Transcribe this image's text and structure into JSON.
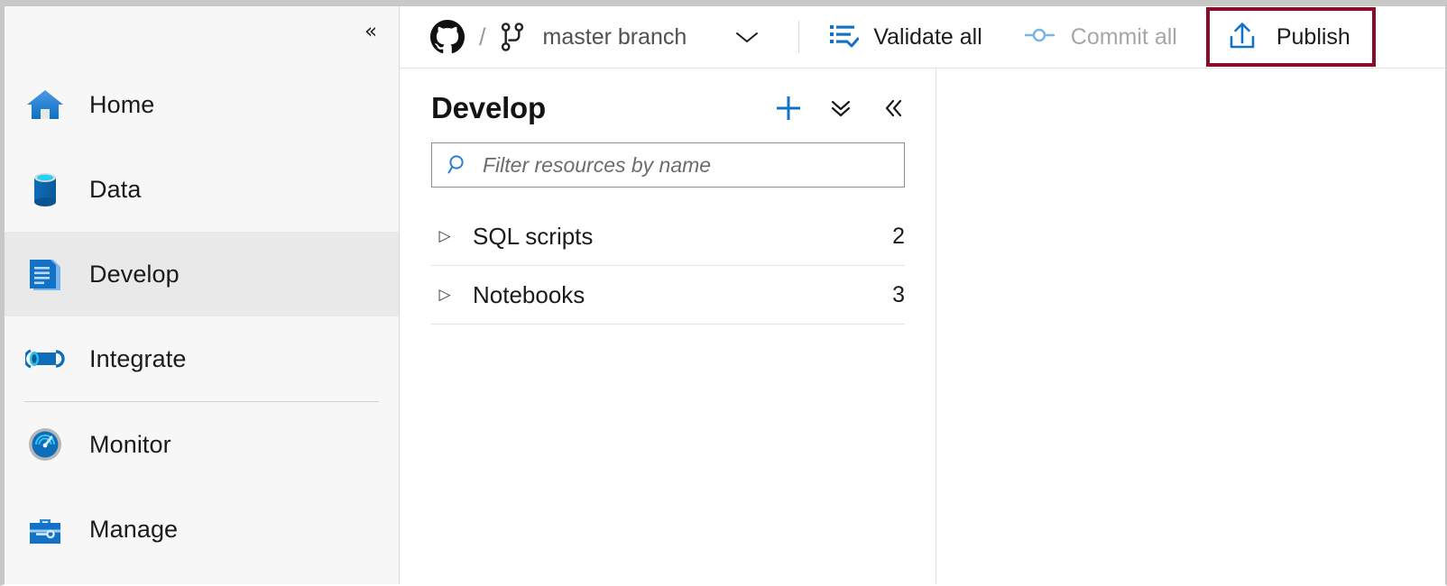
{
  "sidebar": {
    "collapse_icon": "«",
    "items": [
      {
        "label": "Home",
        "icon": "home-icon",
        "selected": false
      },
      {
        "label": "Data",
        "icon": "database-icon",
        "selected": false
      },
      {
        "label": "Develop",
        "icon": "document-icon",
        "selected": true
      },
      {
        "label": "Integrate",
        "icon": "pipeline-icon",
        "selected": false
      },
      {
        "label": "Monitor",
        "icon": "gauge-icon",
        "selected": false
      },
      {
        "label": "Manage",
        "icon": "toolbox-icon",
        "selected": false
      }
    ]
  },
  "topbar": {
    "github_icon": "github-icon",
    "separator": "/",
    "branch_icon": "git-branch-icon",
    "branch_name": "master branch",
    "branch_chevron_icon": "chevron-down-icon",
    "validate_all": {
      "label": "Validate all",
      "icon": "list-check-icon",
      "enabled": true
    },
    "commit_all": {
      "label": "Commit all",
      "icon": "commit-node-icon",
      "enabled": false
    },
    "publish": {
      "label": "Publish",
      "icon": "publish-upload-icon",
      "enabled": true,
      "highlight_color": "#8a0b2b"
    }
  },
  "panel": {
    "title": "Develop",
    "actions": [
      {
        "name": "add-new-resource-button",
        "icon": "plus-icon",
        "glyph": "+"
      },
      {
        "name": "collapse-all-button",
        "icon": "double-chevron-down-icon",
        "glyph": "ˇ"
      },
      {
        "name": "collapse-panel-button",
        "icon": "double-chevron-left-icon",
        "glyph": "«"
      }
    ],
    "search": {
      "placeholder": "Filter resources by name",
      "value": "",
      "icon": "search-icon"
    },
    "tree": [
      {
        "label": "SQL scripts",
        "count": "2",
        "expanded": false,
        "arrow": "▷"
      },
      {
        "label": "Notebooks",
        "count": "3",
        "expanded": false,
        "arrow": "▷"
      }
    ]
  },
  "colors": {
    "accent_blue": "#1272c8",
    "highlight_red": "#8a0b2b",
    "selected_bg": "#e9e9e9",
    "sidebar_bg": "#f7f7f7"
  }
}
